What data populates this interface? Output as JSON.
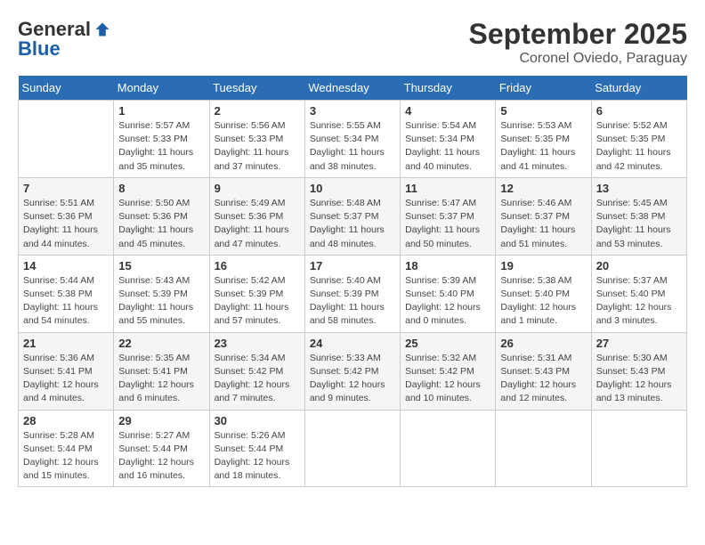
{
  "logo": {
    "general": "General",
    "blue": "Blue"
  },
  "title": "September 2025",
  "subtitle": "Coronel Oviedo, Paraguay",
  "days_of_week": [
    "Sunday",
    "Monday",
    "Tuesday",
    "Wednesday",
    "Thursday",
    "Friday",
    "Saturday"
  ],
  "weeks": [
    [
      {
        "day": "",
        "info": ""
      },
      {
        "day": "1",
        "info": "Sunrise: 5:57 AM\nSunset: 5:33 PM\nDaylight: 11 hours\nand 35 minutes."
      },
      {
        "day": "2",
        "info": "Sunrise: 5:56 AM\nSunset: 5:33 PM\nDaylight: 11 hours\nand 37 minutes."
      },
      {
        "day": "3",
        "info": "Sunrise: 5:55 AM\nSunset: 5:34 PM\nDaylight: 11 hours\nand 38 minutes."
      },
      {
        "day": "4",
        "info": "Sunrise: 5:54 AM\nSunset: 5:34 PM\nDaylight: 11 hours\nand 40 minutes."
      },
      {
        "day": "5",
        "info": "Sunrise: 5:53 AM\nSunset: 5:35 PM\nDaylight: 11 hours\nand 41 minutes."
      },
      {
        "day": "6",
        "info": "Sunrise: 5:52 AM\nSunset: 5:35 PM\nDaylight: 11 hours\nand 42 minutes."
      }
    ],
    [
      {
        "day": "7",
        "info": "Sunrise: 5:51 AM\nSunset: 5:36 PM\nDaylight: 11 hours\nand 44 minutes."
      },
      {
        "day": "8",
        "info": "Sunrise: 5:50 AM\nSunset: 5:36 PM\nDaylight: 11 hours\nand 45 minutes."
      },
      {
        "day": "9",
        "info": "Sunrise: 5:49 AM\nSunset: 5:36 PM\nDaylight: 11 hours\nand 47 minutes."
      },
      {
        "day": "10",
        "info": "Sunrise: 5:48 AM\nSunset: 5:37 PM\nDaylight: 11 hours\nand 48 minutes."
      },
      {
        "day": "11",
        "info": "Sunrise: 5:47 AM\nSunset: 5:37 PM\nDaylight: 11 hours\nand 50 minutes."
      },
      {
        "day": "12",
        "info": "Sunrise: 5:46 AM\nSunset: 5:37 PM\nDaylight: 11 hours\nand 51 minutes."
      },
      {
        "day": "13",
        "info": "Sunrise: 5:45 AM\nSunset: 5:38 PM\nDaylight: 11 hours\nand 53 minutes."
      }
    ],
    [
      {
        "day": "14",
        "info": "Sunrise: 5:44 AM\nSunset: 5:38 PM\nDaylight: 11 hours\nand 54 minutes."
      },
      {
        "day": "15",
        "info": "Sunrise: 5:43 AM\nSunset: 5:39 PM\nDaylight: 11 hours\nand 55 minutes."
      },
      {
        "day": "16",
        "info": "Sunrise: 5:42 AM\nSunset: 5:39 PM\nDaylight: 11 hours\nand 57 minutes."
      },
      {
        "day": "17",
        "info": "Sunrise: 5:40 AM\nSunset: 5:39 PM\nDaylight: 11 hours\nand 58 minutes."
      },
      {
        "day": "18",
        "info": "Sunrise: 5:39 AM\nSunset: 5:40 PM\nDaylight: 12 hours\nand 0 minutes."
      },
      {
        "day": "19",
        "info": "Sunrise: 5:38 AM\nSunset: 5:40 PM\nDaylight: 12 hours\nand 1 minute."
      },
      {
        "day": "20",
        "info": "Sunrise: 5:37 AM\nSunset: 5:40 PM\nDaylight: 12 hours\nand 3 minutes."
      }
    ],
    [
      {
        "day": "21",
        "info": "Sunrise: 5:36 AM\nSunset: 5:41 PM\nDaylight: 12 hours\nand 4 minutes."
      },
      {
        "day": "22",
        "info": "Sunrise: 5:35 AM\nSunset: 5:41 PM\nDaylight: 12 hours\nand 6 minutes."
      },
      {
        "day": "23",
        "info": "Sunrise: 5:34 AM\nSunset: 5:42 PM\nDaylight: 12 hours\nand 7 minutes."
      },
      {
        "day": "24",
        "info": "Sunrise: 5:33 AM\nSunset: 5:42 PM\nDaylight: 12 hours\nand 9 minutes."
      },
      {
        "day": "25",
        "info": "Sunrise: 5:32 AM\nSunset: 5:42 PM\nDaylight: 12 hours\nand 10 minutes."
      },
      {
        "day": "26",
        "info": "Sunrise: 5:31 AM\nSunset: 5:43 PM\nDaylight: 12 hours\nand 12 minutes."
      },
      {
        "day": "27",
        "info": "Sunrise: 5:30 AM\nSunset: 5:43 PM\nDaylight: 12 hours\nand 13 minutes."
      }
    ],
    [
      {
        "day": "28",
        "info": "Sunrise: 5:28 AM\nSunset: 5:44 PM\nDaylight: 12 hours\nand 15 minutes."
      },
      {
        "day": "29",
        "info": "Sunrise: 5:27 AM\nSunset: 5:44 PM\nDaylight: 12 hours\nand 16 minutes."
      },
      {
        "day": "30",
        "info": "Sunrise: 5:26 AM\nSunset: 5:44 PM\nDaylight: 12 hours\nand 18 minutes."
      },
      {
        "day": "",
        "info": ""
      },
      {
        "day": "",
        "info": ""
      },
      {
        "day": "",
        "info": ""
      },
      {
        "day": "",
        "info": ""
      }
    ]
  ]
}
